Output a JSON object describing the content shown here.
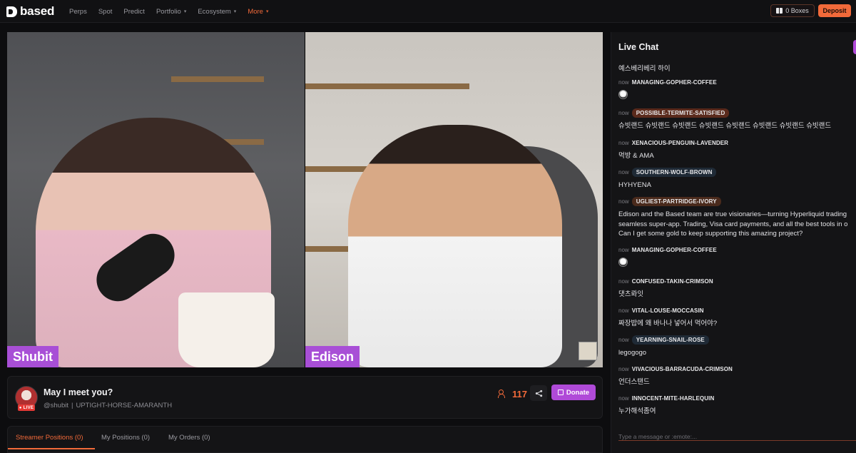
{
  "nav": {
    "logo": "based",
    "items": [
      {
        "label": "Perps"
      },
      {
        "label": "Spot"
      },
      {
        "label": "Predict"
      },
      {
        "label": "Portfolio"
      },
      {
        "label": "Ecosystem"
      },
      {
        "label": "More"
      }
    ],
    "boxes_label": "0 Boxes",
    "deposit_label": "Deposit",
    "accent_color": "#f26a3a"
  },
  "video": {
    "left_name": "Shubit",
    "right_name": "Edison"
  },
  "stream": {
    "title": "May I meet you?",
    "handle": "@shubit",
    "separator": "|",
    "username": "UPTIGHT-HORSE-AMARANTH",
    "live_label": "LIVE",
    "viewers": "117",
    "donate_label": "Donate"
  },
  "positions_tabs": [
    {
      "label": "Streamer Positions (0)"
    },
    {
      "label": "My Positions (0)"
    },
    {
      "label": "My Orders (0)"
    }
  ],
  "chat": {
    "title": "Live Chat",
    "first_message": "예스베리베리 하이",
    "input_placeholder": "Type a message or :emote:...",
    "messages": [
      {
        "time": "now",
        "user": "MANAGING-GOPHER-COFFEE",
        "text": "",
        "emote": "ghost-emote-icon"
      },
      {
        "time": "now",
        "user": "POSSIBLE-TERMITE-SATISFIED",
        "badge_color": "#5a2a1c",
        "text": "슈빗랜드 슈빗랜드 슈빗랜드 슈빗랜드 슈빗랜드 슈빗랜드 슈빗랜드 슈빗랜드"
      },
      {
        "time": "now",
        "user": "XENACIOUS-PENGUIN-LAVENDER",
        "text": "먹방 & AMA"
      },
      {
        "time": "now",
        "user": "SOUTHERN-WOLF-BROWN",
        "badge_color": "#1f2a36",
        "text": "HYHYENA"
      },
      {
        "time": "now",
        "user": "UGLIEST-PARTRIDGE-IVORY",
        "badge_color": "#4a2a1c",
        "text_lines": [
          "Edison and the Based team are true visionaries—turning Hyperliquid trading",
          "seamless super-app. Trading, Visa card payments, and all the best tools in o",
          "Can I get some gold to keep supporting this amazing project?"
        ]
      },
      {
        "time": "now",
        "user": "MANAGING-GOPHER-COFFEE",
        "text": "",
        "emote": "ghost-emote-icon"
      },
      {
        "time": "now",
        "user": "CONFUSED-TAKIN-CRIMSON",
        "text": "댓츠롸잇"
      },
      {
        "time": "now",
        "user": "VITAL-LOUSE-MOCCASIN",
        "text": "짜장밥에 왜 바나나 넣어서 먹어야?"
      },
      {
        "time": "now",
        "user": "YEARNING-SNAIL-ROSE",
        "badge_color": "#1f2a36",
        "text": "legogogo"
      },
      {
        "time": "now",
        "user": "VIVACIOUS-BARRACUDA-CRIMSON",
        "text": "언더스탠드"
      },
      {
        "time": "now",
        "user": "INNOCENT-MITE-HARLEQUIN",
        "text": "누가해석좀여"
      }
    ]
  }
}
